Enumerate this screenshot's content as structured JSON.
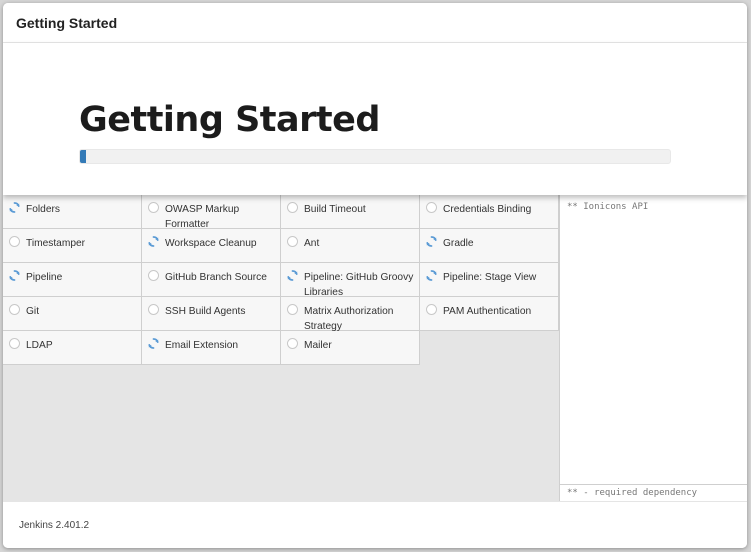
{
  "header": {
    "title": "Getting Started"
  },
  "banner": {
    "heading": "Getting Started",
    "progress": 0.01
  },
  "plugins": [
    {
      "label": "Folders",
      "status": "installing"
    },
    {
      "label": "OWASP Markup Formatter",
      "status": "pending"
    },
    {
      "label": "Build Timeout",
      "status": "pending"
    },
    {
      "label": "Credentials Binding",
      "status": "pending"
    },
    {
      "label": "Timestamper",
      "status": "pending"
    },
    {
      "label": "Workspace Cleanup",
      "status": "installing"
    },
    {
      "label": "Ant",
      "status": "pending"
    },
    {
      "label": "Gradle",
      "status": "installing"
    },
    {
      "label": "Pipeline",
      "status": "installing"
    },
    {
      "label": "GitHub Branch Source",
      "status": "pending"
    },
    {
      "label": "Pipeline: GitHub Groovy Libraries",
      "status": "installing"
    },
    {
      "label": "Pipeline: Stage View",
      "status": "installing"
    },
    {
      "label": "Git",
      "status": "pending"
    },
    {
      "label": "SSH Build Agents",
      "status": "pending"
    },
    {
      "label": "Matrix Authorization Strategy",
      "status": "pending"
    },
    {
      "label": "PAM Authentication",
      "status": "pending"
    },
    {
      "label": "LDAP",
      "status": "pending"
    },
    {
      "label": "Email Extension",
      "status": "installing"
    },
    {
      "label": "Mailer",
      "status": "pending"
    }
  ],
  "dependencies": {
    "text": "** Ionicons API",
    "legend": "** - required dependency"
  },
  "footer": {
    "version": "Jenkins 2.401.2"
  },
  "colors": {
    "accent": "#337ab7",
    "spinner": "#5b9bd5"
  }
}
